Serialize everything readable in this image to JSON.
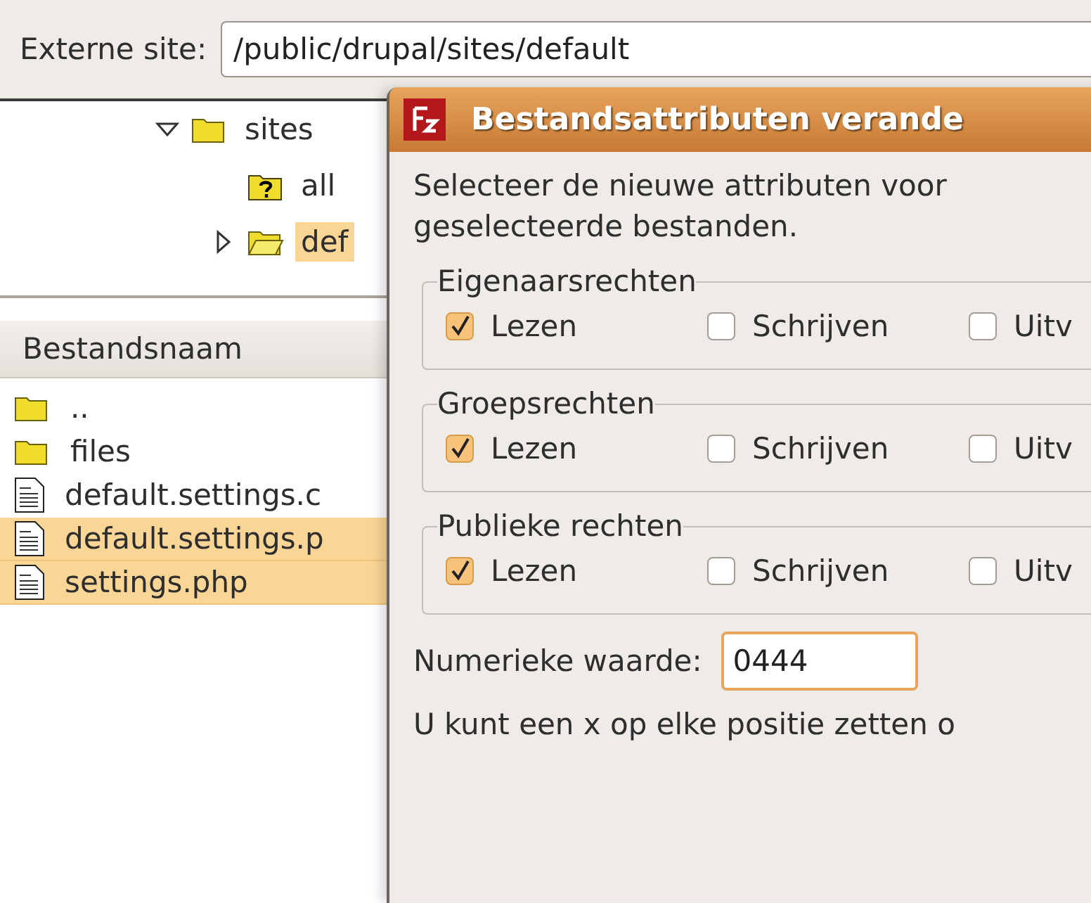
{
  "remote_site": {
    "label": "Externe site:",
    "value": "/public/drupal/sites/default"
  },
  "tree": [
    {
      "name": "sites",
      "kind": "plain",
      "expanded": true,
      "selected": false,
      "children": [
        {
          "name": "all",
          "kind": "unknown",
          "selected": false
        },
        {
          "name": "def",
          "kind": "open",
          "expanded": false,
          "selected": true
        }
      ]
    }
  ],
  "file_list": {
    "column": "Bestandsnaam",
    "rows": [
      {
        "name": "..",
        "kind": "folder",
        "selected": false
      },
      {
        "name": "files",
        "kind": "folder",
        "selected": false
      },
      {
        "name": "default.settings.c",
        "kind": "file",
        "selected": false
      },
      {
        "name": "default.settings.p",
        "kind": "file",
        "selected": true
      },
      {
        "name": "settings.php",
        "kind": "file",
        "selected": true
      }
    ]
  },
  "dialog": {
    "title": "Bestandsattributen verande",
    "intro": "Selecteer de nieuwe attributen voor\ngeselecteerde bestanden.",
    "groups": [
      {
        "title": "Eigenaarsrechten",
        "options": [
          {
            "label": "Lezen",
            "checked": true
          },
          {
            "label": "Schrijven",
            "checked": false
          },
          {
            "label": "Uitv",
            "checked": false
          }
        ]
      },
      {
        "title": "Groepsrechten",
        "options": [
          {
            "label": "Lezen",
            "checked": true
          },
          {
            "label": "Schrijven",
            "checked": false
          },
          {
            "label": "Uitv",
            "checked": false
          }
        ]
      },
      {
        "title": "Publieke rechten",
        "options": [
          {
            "label": "Lezen",
            "checked": true
          },
          {
            "label": "Schrijven",
            "checked": false
          },
          {
            "label": "Uitv",
            "checked": false
          }
        ]
      }
    ],
    "numeric": {
      "label": "Numerieke waarde:",
      "value": "0444"
    },
    "hint": "U kunt een x op elke positie zetten o"
  }
}
